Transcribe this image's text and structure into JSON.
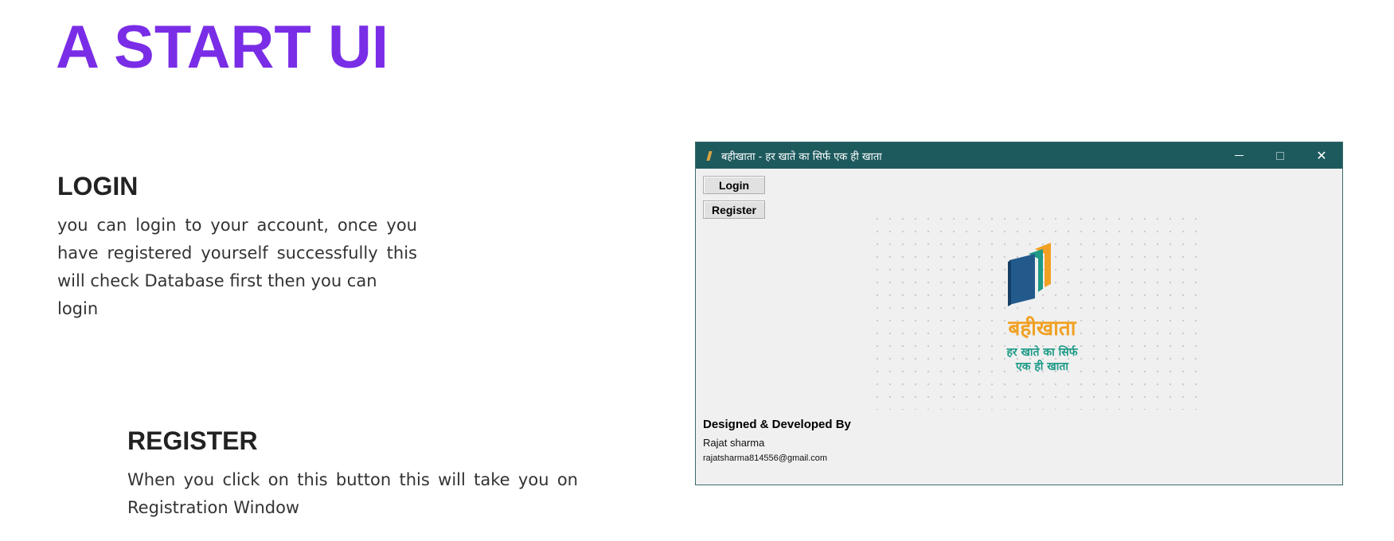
{
  "page": {
    "title": "A START UI",
    "accent_color": "#7a2de6"
  },
  "login_section": {
    "heading": "LOGIN",
    "text_main": "you can login to your account, once you have registered yourself successfully this will check Database first then you can",
    "text_last": "login"
  },
  "register_section": {
    "heading": "REGISTER",
    "text": "When you click on this button this will take you on Registration Window"
  },
  "app_window": {
    "titlebar_color": "#1d5a5e",
    "icon": "app-book-icon",
    "title": "बहीखाता - हर खाते का सिर्फ एक ही खाता",
    "controls": {
      "minimize_icon": "minimize-icon",
      "maximize_icon": "maximize-icon",
      "close_icon": "close-icon",
      "close_glyph": "✕"
    },
    "buttons": {
      "login": "Login",
      "register": "Register"
    },
    "logo": {
      "name": "बहीखाता",
      "tagline_line1": "हर खाते का सिर्फ",
      "tagline_line2": "एक ही खाता",
      "colors": {
        "orange": "#f0a123",
        "teal": "#1e9a87",
        "blue": "#235a8c"
      }
    },
    "credits": {
      "heading": "Designed & Developed By",
      "name": "Rajat sharma",
      "email": "rajatsharma814556@gmail.com"
    }
  }
}
